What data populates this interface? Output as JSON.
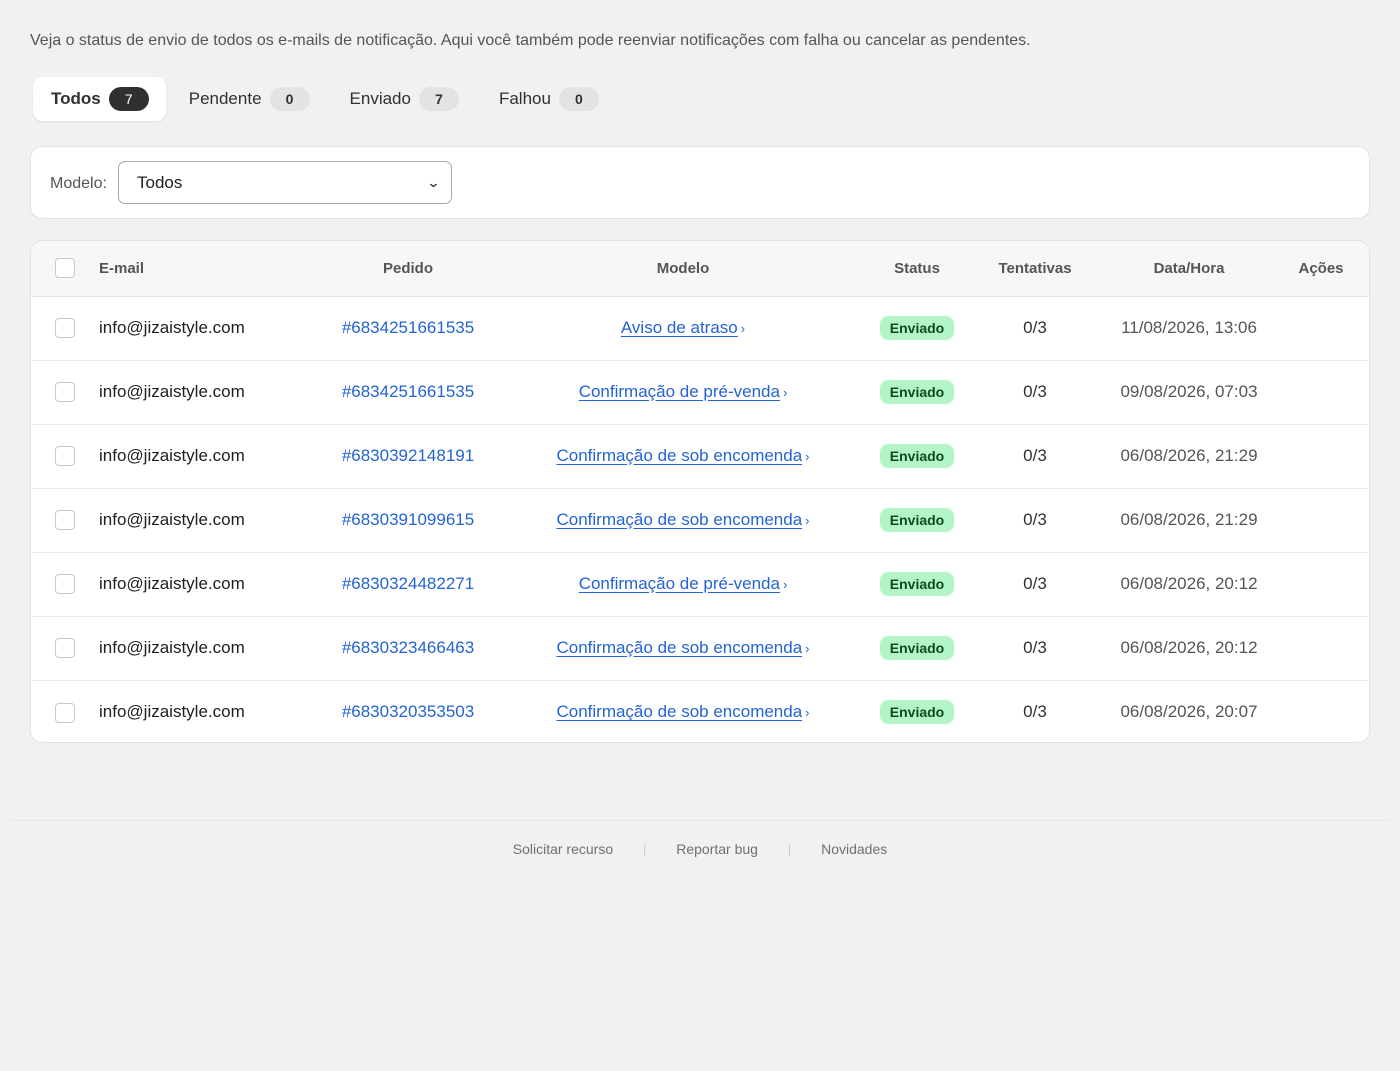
{
  "description": "Veja o status de envio de todos os e-mails de notificação. Aqui você também pode reenviar notificações com falha ou cancelar as pendentes.",
  "tabs": [
    {
      "label": "Todos",
      "count": "7"
    },
    {
      "label": "Pendente",
      "count": "0"
    },
    {
      "label": "Enviado",
      "count": "7"
    },
    {
      "label": "Falhou",
      "count": "0"
    }
  ],
  "filter": {
    "label": "Modelo:",
    "selected": "Todos"
  },
  "table": {
    "headers": {
      "email": "E-mail",
      "order": "Pedido",
      "model": "Modelo",
      "status": "Status",
      "attempts": "Tentativas",
      "datetime": "Data/Hora",
      "actions": "Ações"
    },
    "rows": [
      {
        "email": "info@jizaistyle.com",
        "order": "#6834251661535",
        "model": "Aviso de atraso",
        "status": "Enviado",
        "attempts": "0/3",
        "datetime": "11/08/2026, 13:06"
      },
      {
        "email": "info@jizaistyle.com",
        "order": "#6834251661535",
        "model": "Confirmação de pré-venda",
        "status": "Enviado",
        "attempts": "0/3",
        "datetime": "09/08/2026, 07:03"
      },
      {
        "email": "info@jizaistyle.com",
        "order": "#6830392148191",
        "model": "Confirmação de sob encomenda",
        "status": "Enviado",
        "attempts": "0/3",
        "datetime": "06/08/2026, 21:29"
      },
      {
        "email": "info@jizaistyle.com",
        "order": "#6830391099615",
        "model": "Confirmação de sob encomenda",
        "status": "Enviado",
        "attempts": "0/3",
        "datetime": "06/08/2026, 21:29"
      },
      {
        "email": "info@jizaistyle.com",
        "order": "#6830324482271",
        "model": "Confirmação de pré-venda",
        "status": "Enviado",
        "attempts": "0/3",
        "datetime": "06/08/2026, 20:12"
      },
      {
        "email": "info@jizaistyle.com",
        "order": "#6830323466463",
        "model": "Confirmação de sob encomenda",
        "status": "Enviado",
        "attempts": "0/3",
        "datetime": "06/08/2026, 20:12"
      },
      {
        "email": "info@jizaistyle.com",
        "order": "#6830320353503",
        "model": "Confirmação de sob encomenda",
        "status": "Enviado",
        "attempts": "0/3",
        "datetime": "06/08/2026, 20:07"
      }
    ]
  },
  "footer": {
    "links": [
      "Solicitar recurso",
      "Reportar bug",
      "Novidades"
    ]
  },
  "colors": {
    "link": "#2463d4",
    "badge_bg": "#b4f5c8",
    "badge_text": "#0b4a24",
    "active_count_bg": "#303030"
  }
}
